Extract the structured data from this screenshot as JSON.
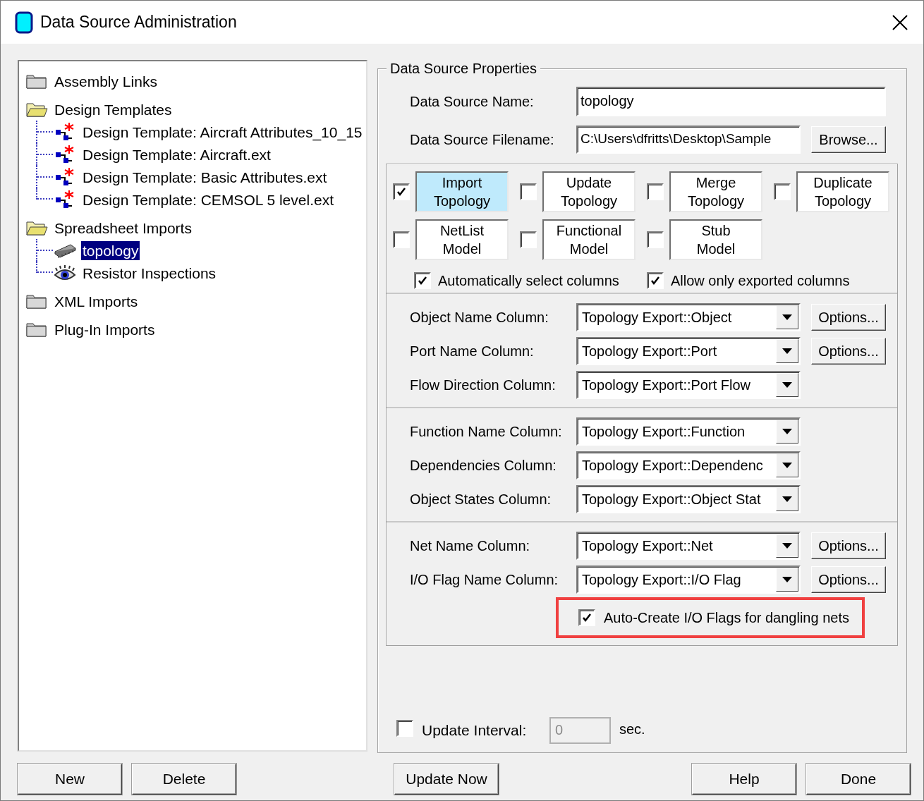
{
  "window": {
    "title": "Data Source Administration"
  },
  "tree": [
    {
      "label": "Assembly Links",
      "kind": "folder",
      "expanded": false,
      "selected": false
    },
    {
      "label": "Design Templates",
      "kind": "folder",
      "expanded": true,
      "selected": false,
      "children": [
        {
          "label": "Design Template: Aircraft Attributes_10_15",
          "kind": "template",
          "selected": false
        },
        {
          "label": "Design Template: Aircraft.ext",
          "kind": "template",
          "selected": false
        },
        {
          "label": "Design Template: Basic Attributes.ext",
          "kind": "template",
          "selected": false
        },
        {
          "label": "Design Template: CEMSOL 5 level.ext",
          "kind": "template",
          "selected": false
        }
      ]
    },
    {
      "label": "Spreadsheet Imports",
      "kind": "folder",
      "expanded": true,
      "selected": false,
      "children": [
        {
          "label": "topology",
          "kind": "chip",
          "selected": true
        },
        {
          "label": "Resistor Inspections",
          "kind": "eye",
          "selected": false
        }
      ]
    },
    {
      "label": "XML Imports",
      "kind": "folder",
      "expanded": false,
      "selected": false
    },
    {
      "label": "Plug-In Imports",
      "kind": "folder",
      "expanded": false,
      "selected": false
    }
  ],
  "properties": {
    "title": "Data Source Properties",
    "name_label": "Data Source Name:",
    "name_value": "topology",
    "filename_label": "Data Source Filename:",
    "filename_value": "C:\\Users\\dfritts\\Desktop\\Sample",
    "browse": "Browse...",
    "modes": [
      {
        "label": "Import\nTopology",
        "checked": true,
        "highlighted": true
      },
      {
        "label": "Update\nTopology",
        "checked": false,
        "highlighted": false
      },
      {
        "label": "Merge\nTopology",
        "checked": false,
        "highlighted": false
      },
      {
        "label": "Duplicate\nTopology",
        "checked": false,
        "highlighted": false
      },
      {
        "label": "NetList\nModel",
        "checked": false,
        "highlighted": false
      },
      {
        "label": "Functional\nModel",
        "checked": false,
        "highlighted": false
      },
      {
        "label": "Stub\nModel",
        "checked": false,
        "highlighted": false
      }
    ],
    "options": [
      {
        "label": "Automatically select columns",
        "checked": true
      },
      {
        "label": "Allow only exported columns",
        "checked": true
      }
    ],
    "column_groups": [
      [
        {
          "label": "Object Name Column:",
          "value": "Topology Export::Object",
          "button": "Options..."
        },
        {
          "label": "Port Name Column:",
          "value": "Topology Export::Port",
          "button": "Options..."
        },
        {
          "label": "Flow Direction Column:",
          "value": "Topology Export::Port Flow"
        }
      ],
      [
        {
          "label": "Function Name Column:",
          "value": "Topology Export::Function"
        },
        {
          "label": "Dependencies Column:",
          "value": "Topology Export::Dependenc"
        },
        {
          "label": "Object States Column:",
          "value": "Topology Export::Object Stat"
        }
      ],
      [
        {
          "label": "Net Name Column:",
          "value": "Topology Export::Net",
          "button": "Options..."
        },
        {
          "label": "I/O Flag Name Column:",
          "value": "Topology Export::I/O Flag",
          "button": "Options..."
        }
      ]
    ],
    "auto_create": {
      "label": "Auto-Create I/O Flags for dangling nets",
      "checked": true,
      "highlighted": true
    },
    "update_interval": {
      "label": "Update Interval:",
      "checked": false,
      "value": "0",
      "disabled": true,
      "unit": "sec."
    }
  },
  "footer": {
    "left": [
      "New",
      "Delete"
    ],
    "center": [
      "Update Now"
    ],
    "right": [
      "Help",
      "Done"
    ]
  }
}
